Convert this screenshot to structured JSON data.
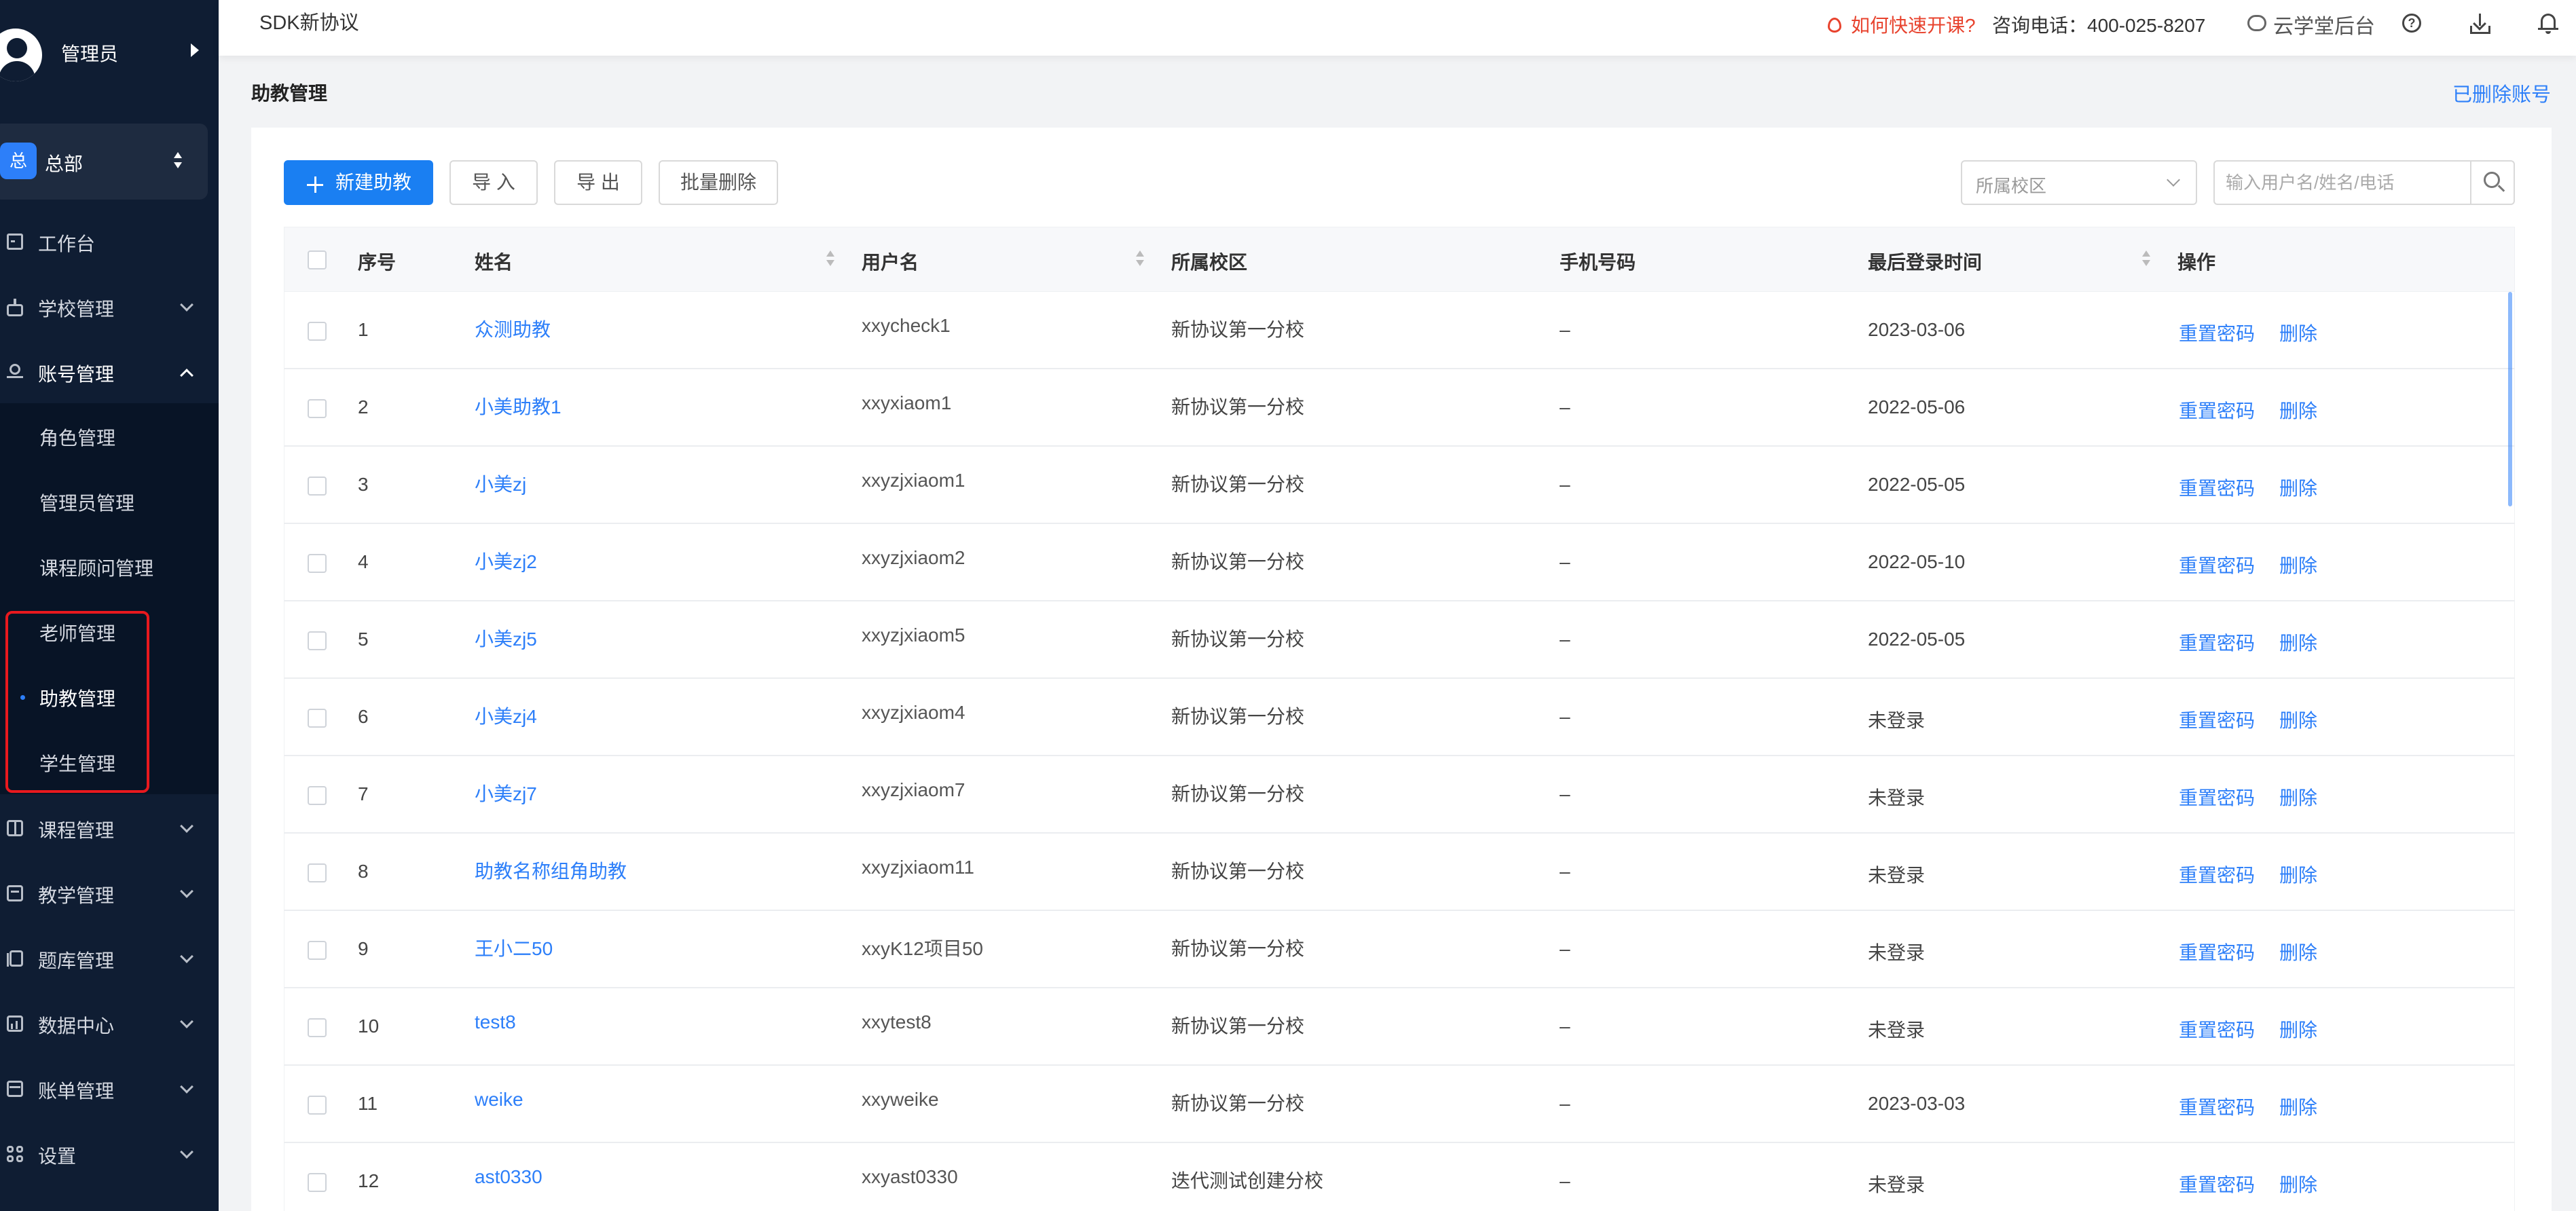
{
  "sidebar": {
    "user_name": "管理员",
    "org": {
      "badge": "总",
      "name": "总部"
    },
    "menu": [
      {
        "label": "工作台",
        "icon": "dashboard-icon"
      },
      {
        "label": "学校管理",
        "icon": "school-icon"
      },
      {
        "label": "账号管理",
        "icon": "account-icon"
      },
      {
        "label": "课程管理",
        "icon": "course-icon"
      },
      {
        "label": "教学管理",
        "icon": "teaching-icon"
      },
      {
        "label": "题库管理",
        "icon": "question-bank-icon"
      },
      {
        "label": "数据中心",
        "icon": "data-center-icon"
      },
      {
        "label": "账单管理",
        "icon": "bill-icon"
      },
      {
        "label": "设置",
        "icon": "settings-icon"
      }
    ],
    "submenu": [
      {
        "label": "角色管理"
      },
      {
        "label": "管理员管理"
      },
      {
        "label": "课程顾问管理"
      },
      {
        "label": "老师管理"
      },
      {
        "label": "助教管理"
      },
      {
        "label": "学生管理"
      }
    ]
  },
  "topbar": {
    "title": "SDK新协议",
    "fast_start": "如何快速开课?",
    "phone": "咨询电话：400-025-8207",
    "backend": "云学堂后台"
  },
  "page": {
    "title": "助教管理",
    "deleted_link": "已删除账号"
  },
  "toolbar": {
    "new_label": "新建助教",
    "import_label": "导 入",
    "export_label": "导 出",
    "batch_delete_label": "批量删除",
    "campus_placeholder": "所属校区",
    "search_placeholder": "输入用户名/姓名/电话"
  },
  "table": {
    "headers": {
      "index": "序号",
      "name": "姓名",
      "username": "用户名",
      "campus": "所属校区",
      "phone": "手机号码",
      "last_login": "最后登录时间",
      "actions": "操作"
    },
    "action_reset": "重置密码",
    "action_delete": "删除",
    "rows": [
      {
        "index": "1",
        "name": "众测助教",
        "username": "xxycheck1",
        "campus": "新协议第一分校",
        "phone": "–",
        "last_login": "2023-03-06"
      },
      {
        "index": "2",
        "name": "小美助教1",
        "username": "xxyxiaom1",
        "campus": "新协议第一分校",
        "phone": "–",
        "last_login": "2022-05-06"
      },
      {
        "index": "3",
        "name": "小美zj",
        "username": "xxyzjxiaom1",
        "campus": "新协议第一分校",
        "phone": "–",
        "last_login": "2022-05-05"
      },
      {
        "index": "4",
        "name": "小美zj2",
        "username": "xxyzjxiaom2",
        "campus": "新协议第一分校",
        "phone": "–",
        "last_login": "2022-05-10"
      },
      {
        "index": "5",
        "name": "小美zj5",
        "username": "xxyzjxiaom5",
        "campus": "新协议第一分校",
        "phone": "–",
        "last_login": "2022-05-05"
      },
      {
        "index": "6",
        "name": "小美zj4",
        "username": "xxyzjxiaom4",
        "campus": "新协议第一分校",
        "phone": "–",
        "last_login": "未登录"
      },
      {
        "index": "7",
        "name": "小美zj7",
        "username": "xxyzjxiaom7",
        "campus": "新协议第一分校",
        "phone": "–",
        "last_login": "未登录"
      },
      {
        "index": "8",
        "name": "助教名称组角助教",
        "username": "xxyzjxiaom11",
        "campus": "新协议第一分校",
        "phone": "–",
        "last_login": "未登录"
      },
      {
        "index": "9",
        "name": "王小二50",
        "username": "xxyK12项目50",
        "campus": "新协议第一分校",
        "phone": "–",
        "last_login": "未登录"
      },
      {
        "index": "10",
        "name": "test8",
        "username": "xxytest8",
        "campus": "新协议第一分校",
        "phone": "–",
        "last_login": "未登录"
      },
      {
        "index": "11",
        "name": "weike",
        "username": "xxyweike",
        "campus": "新协议第一分校",
        "phone": "–",
        "last_login": "2023-03-03"
      },
      {
        "index": "12",
        "name": "ast0330",
        "username": "xxyast0330",
        "campus": "迭代测试创建分校",
        "phone": "–",
        "last_login": "未登录"
      }
    ]
  }
}
